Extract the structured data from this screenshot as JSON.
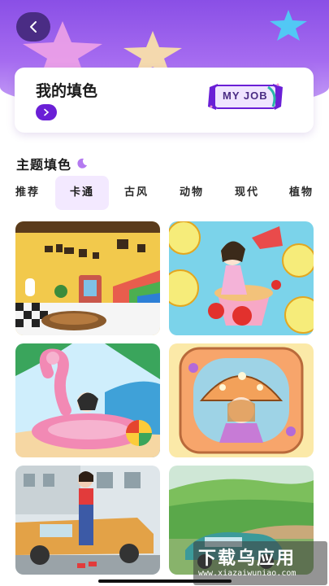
{
  "header": {
    "back_icon": "chevron-left-icon",
    "colors": {
      "gradient_top": "#8a4fe6",
      "gradient_bottom": "#c9a6f7",
      "star_pink": "#f3a6e6",
      "star_yellow": "#fde6a6",
      "star_blue": "#52c8f5"
    }
  },
  "my_coloring": {
    "title": "我的填色",
    "go_icon": "chevron-right-icon",
    "badge_text": "MY JOB",
    "accent": "#6a1fd6"
  },
  "section": {
    "title": "主题填色",
    "icon": "moon-icon"
  },
  "tabs": [
    {
      "label": "推荐",
      "active": false
    },
    {
      "label": "卡通",
      "active": true
    },
    {
      "label": "古风",
      "active": false
    },
    {
      "label": "动物",
      "active": false
    },
    {
      "label": "现代",
      "active": false
    },
    {
      "label": "植物",
      "active": false
    }
  ],
  "artworks": [
    {
      "name": "room-interior-artwork"
    },
    {
      "name": "fruit-girl-artwork"
    },
    {
      "name": "flamingo-beach-artwork"
    },
    {
      "name": "mushroom-girl-artwork"
    },
    {
      "name": "street-girl-car-artwork"
    },
    {
      "name": "landscape-car-artwork"
    }
  ],
  "watermark": {
    "main": "下载乌应用",
    "url": "www.xiazaiwuniao.com"
  }
}
